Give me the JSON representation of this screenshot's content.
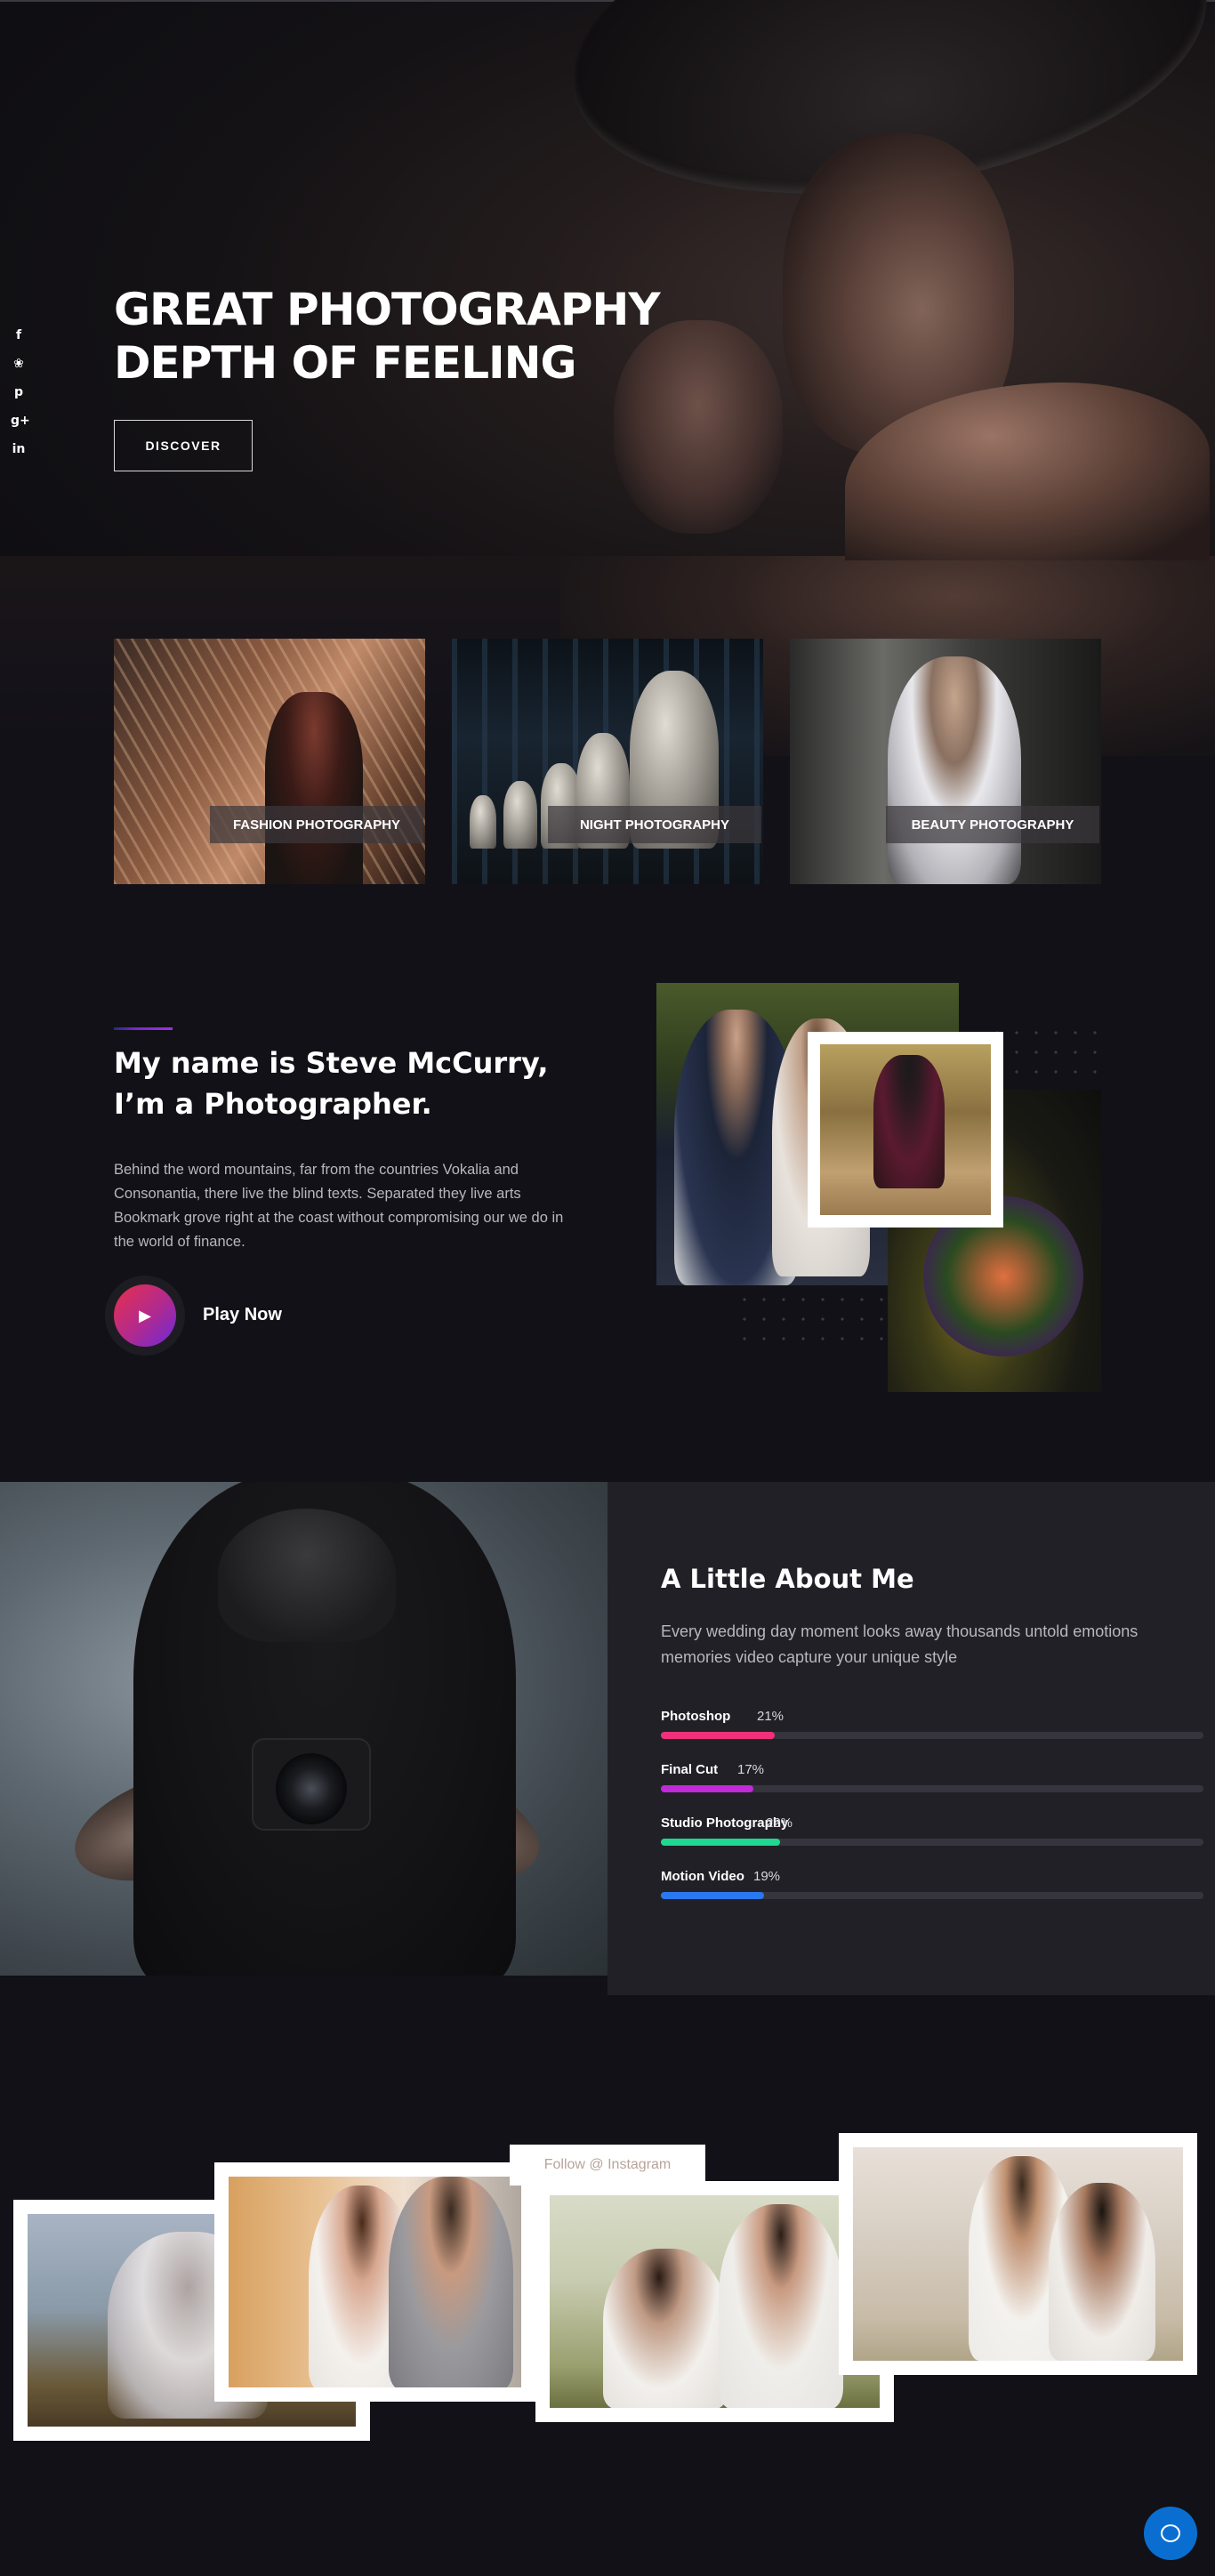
{
  "social": [
    {
      "icon": "facebook-icon",
      "glyph": "f"
    },
    {
      "icon": "twitter-icon",
      "glyph": "❀"
    },
    {
      "icon": "pinterest-icon",
      "glyph": "p"
    },
    {
      "icon": "google-plus-icon",
      "glyph": "g+"
    },
    {
      "icon": "linkedin-icon",
      "glyph": "in"
    }
  ],
  "hero": {
    "title_line1": "GREAT PHOTOGRAPHY",
    "title_line2": "DEPTH OF FEELING",
    "button": "DISCOVER"
  },
  "categories": [
    {
      "label": "FASHION PHOTOGRAPHY"
    },
    {
      "label": "NIGHT PHOTOGRAPHY"
    },
    {
      "label": "BEAUTY PHOTOGRAPHY"
    }
  ],
  "about": {
    "title": "My name is Steve McCurry, I’m a Photographer.",
    "text": "Behind the word mountains, far from the countries Vokalia and Consonantia, there live the blind texts. Separated they live arts Bookmark grove right at the coast without compromising our we do in the world of finance.",
    "play_label": "Play Now"
  },
  "skills_section": {
    "title": "A Little About Me",
    "text": "Every wedding day moment looks away thousands untold emotions memories video capture your unique style",
    "skills": [
      {
        "name": "Photoshop",
        "percent_text": "21%",
        "value": 21,
        "color": "#f0307a"
      },
      {
        "name": "Final Cut",
        "percent_text": "17%",
        "value": 17,
        "color": "#c02ad8"
      },
      {
        "name": "Studio Photography",
        "percent_text": "22%",
        "value": 22,
        "color": "#20d890"
      },
      {
        "name": "Motion Video",
        "percent_text": "19%",
        "value": 19,
        "color": "#2a78f0"
      }
    ]
  },
  "instagram": {
    "follow_label": "Follow @ Instagram"
  },
  "colors": {
    "background": "#121117",
    "panel": "#212027",
    "chat_button": "#0a6ed1",
    "accent_gradient": [
      "#e8304a",
      "#b02a90",
      "#6a2ad8"
    ]
  }
}
